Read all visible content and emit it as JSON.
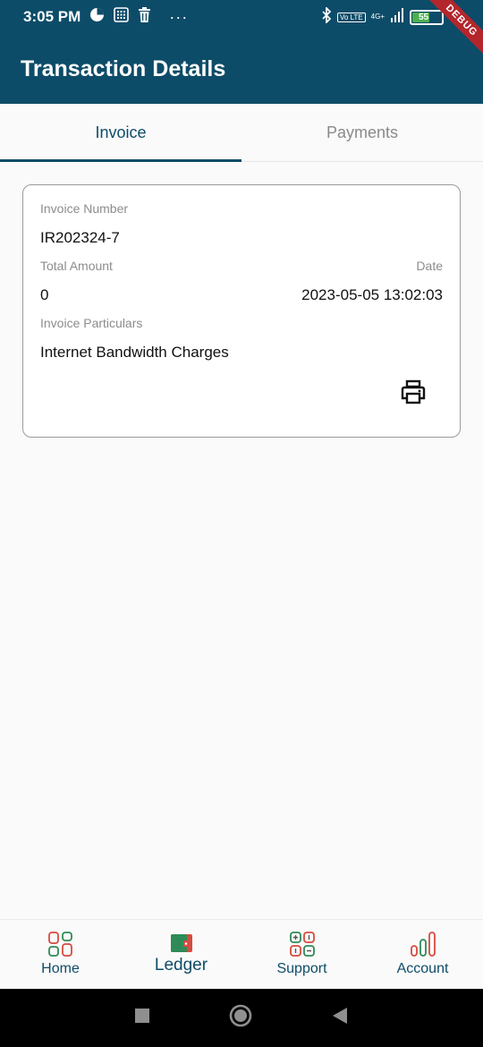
{
  "status_bar": {
    "time": "3:05 PM",
    "dots": "···",
    "volte": "Vo LTE",
    "network": "4G+",
    "battery": "55"
  },
  "debug_banner": "DEBUG",
  "app_bar": {
    "title": "Transaction Details"
  },
  "tabs": [
    {
      "label": "Invoice",
      "active": true
    },
    {
      "label": "Payments",
      "active": false
    }
  ],
  "invoice": {
    "number_label": "Invoice Number",
    "number_value": "IR202324-7",
    "total_label": "Total Amount",
    "total_value": "0",
    "date_label": "Date",
    "date_value": "2023-05-05 13:02:03",
    "particulars_label": "Invoice Particulars",
    "particulars_value": "Internet Bandwidth Charges",
    "print_icon": "printer-icon"
  },
  "bottom_nav": [
    {
      "label": "Home",
      "icon": "home-grid-icon"
    },
    {
      "label": "Ledger",
      "icon": "wallet-icon",
      "active": true
    },
    {
      "label": "Support",
      "icon": "support-grid-icon"
    },
    {
      "label": "Account",
      "icon": "bar-chart-icon"
    }
  ],
  "colors": {
    "primary": "#0d4c68",
    "accent_red": "#d64b3f",
    "accent_green": "#2e8b57"
  }
}
